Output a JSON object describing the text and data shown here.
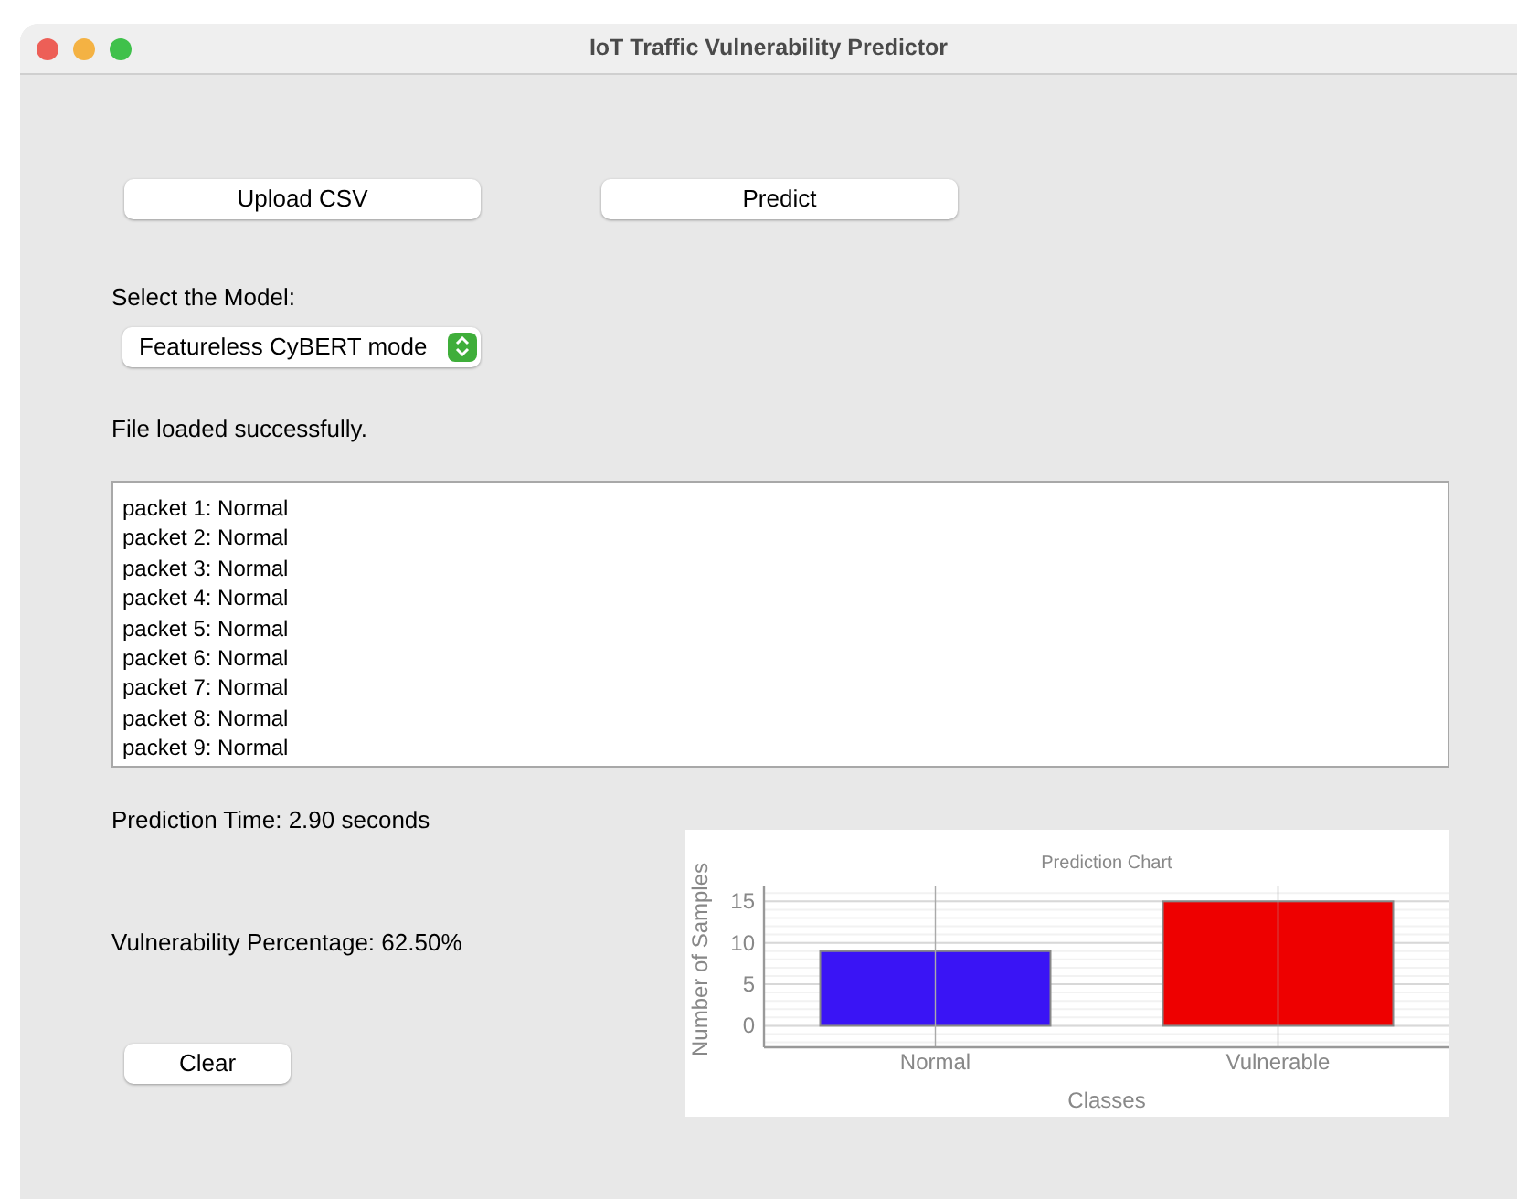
{
  "window": {
    "title": "IoT Traffic Vulnerability Predictor"
  },
  "buttons": {
    "upload": "Upload CSV",
    "predict": "Predict",
    "clear": "Clear"
  },
  "model_label": "Select the Model:",
  "model_select": {
    "value": "Featureless CyBERT mode"
  },
  "status": "File loaded successfully.",
  "results": [
    "packet 1: Normal",
    "packet 2: Normal",
    "packet 3: Normal",
    "packet 4: Normal",
    "packet 5: Normal",
    "packet 6: Normal",
    "packet 7: Normal",
    "packet 8: Normal",
    "packet 9: Normal"
  ],
  "prediction_time": "Prediction Time: 2.90 seconds",
  "vulnerability_percentage": "Vulnerability Percentage: 62.50%",
  "chart_data": {
    "type": "bar",
    "title": "Prediction Chart",
    "xlabel": "Classes",
    "ylabel": "Number of Samples",
    "series": [
      {
        "name": "Normal",
        "color": "#3a14f5",
        "values": [
          9,
          null
        ]
      },
      {
        "name": "Vulnerable",
        "color": "#ee0000",
        "values": [
          null,
          15
        ]
      }
    ],
    "stacked": true,
    "grid": true,
    "ylim": [
      -2.6,
      16.8
    ],
    "yticks": [
      0,
      5,
      10,
      15
    ]
  }
}
